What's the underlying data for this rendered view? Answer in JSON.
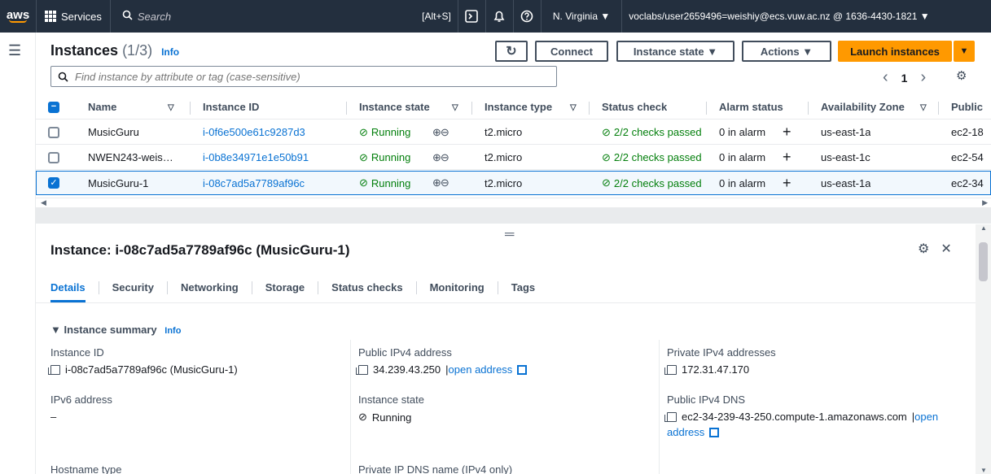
{
  "topbar": {
    "logo": "aws",
    "services": "Services",
    "search_placeholder": "Search",
    "search_shortcut": "[Alt+S]",
    "region": "N. Virginia ▼",
    "account": "voclabs/user2659496=weishiy@ecs.vuw.ac.nz @ 1636-4430-1821 ▼"
  },
  "instances": {
    "title": "Instances",
    "count": "(1/3)",
    "info": "Info",
    "buttons": {
      "refresh": "↻",
      "connect": "Connect",
      "instance_state": "Instance state ▼",
      "actions": "Actions ▼",
      "launch": "Launch instances",
      "launch_menu": "▼"
    },
    "search_placeholder": "Find instance by attribute or tag (case-sensitive)",
    "pager": {
      "prev": "‹",
      "page": "1",
      "next": "›"
    },
    "columns": [
      "Name",
      "Instance ID",
      "Instance state",
      "Instance type",
      "Status check",
      "Alarm status",
      "Availability Zone",
      "Public"
    ],
    "rows": [
      {
        "name": "MusicGuru",
        "id": "i-0f6e500e61c9287d3",
        "state": "Running",
        "type": "t2.micro",
        "status": "2/2 checks passed",
        "alarm": "0 in alarm",
        "az": "us-east-1a",
        "public": "ec2-18",
        "selected": false
      },
      {
        "name": "NWEN243-weis…",
        "id": "i-0b8e34971e1e50b91",
        "state": "Running",
        "type": "t2.micro",
        "status": "2/2 checks passed",
        "alarm": "0 in alarm",
        "az": "us-east-1c",
        "public": "ec2-54",
        "selected": false
      },
      {
        "name": "MusicGuru-1",
        "id": "i-08c7ad5a7789af96c",
        "state": "Running",
        "type": "t2.micro",
        "status": "2/2 checks passed",
        "alarm": "0 in alarm",
        "az": "us-east-1a",
        "public": "ec2-34",
        "selected": true
      }
    ]
  },
  "detail": {
    "title": "Instance: i-08c7ad5a7789af96c (MusicGuru-1)",
    "tabs": [
      "Details",
      "Security",
      "Networking",
      "Storage",
      "Status checks",
      "Monitoring",
      "Tags"
    ],
    "summary_heading": "▼ Instance summary",
    "summary_info": "Info",
    "fields": {
      "instance_id": {
        "label": "Instance ID",
        "value": "i-08c7ad5a7789af96c (MusicGuru-1)"
      },
      "public_ipv4": {
        "label": "Public IPv4 address",
        "value": "34.239.43.250",
        "link": "open address"
      },
      "private_ipv4": {
        "label": "Private IPv4 addresses",
        "value": "172.31.47.170"
      },
      "ipv6": {
        "label": "IPv6 address",
        "value": "–"
      },
      "instance_state": {
        "label": "Instance state",
        "value": "Running"
      },
      "public_dns": {
        "label": "Public IPv4 DNS",
        "value": "ec2-34-239-43-250.compute-1.amazonaws.com",
        "link1": "open",
        "link2": "address"
      },
      "hostname_type": {
        "label": "Hostname type"
      },
      "private_dns": {
        "label": "Private IP DNS name (IPv4 only)"
      }
    }
  },
  "colors": {
    "accent": "#0972d3",
    "launch": "#ff9900",
    "topbar": "#232f3e",
    "success": "#037f0c"
  }
}
